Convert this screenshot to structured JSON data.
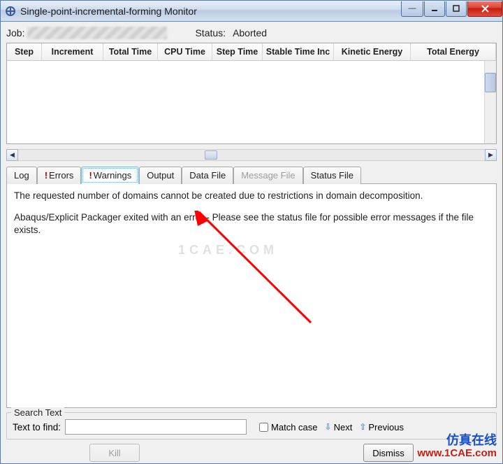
{
  "window": {
    "title": "Single-point-incremental-forming Monitor"
  },
  "job": {
    "label": "Job:",
    "status_label": "Status:",
    "status_value": "Aborted"
  },
  "table": {
    "headers": [
      "Step",
      "Increment",
      "Total Time",
      "CPU Time",
      "Step Time",
      "Stable Time Inc",
      "Kinetic Energy",
      "Total Energy"
    ]
  },
  "tabs": {
    "log": "Log",
    "errors": "Errors",
    "warnings": "Warnings",
    "output": "Output",
    "data_file": "Data File",
    "message_file": "Message File",
    "status_file": "Status File"
  },
  "messages": {
    "line1": "The requested number of domains cannot be created due to restrictions in domain decomposition.",
    "line2": "Abaqus/Explicit Packager exited with an error - Please see the  status file for possible error messages if the file exists."
  },
  "search": {
    "legend": "Search Text",
    "find_label": "Text to find:",
    "match_case": "Match case",
    "next": "Next",
    "previous": "Previous",
    "value": ""
  },
  "buttons": {
    "kill": "Kill",
    "dismiss": "Dismiss"
  },
  "watermark": {
    "cae": "1CAE.COM",
    "brand_cn": "仿真在线",
    "brand_url": "www.1CAE.com"
  }
}
